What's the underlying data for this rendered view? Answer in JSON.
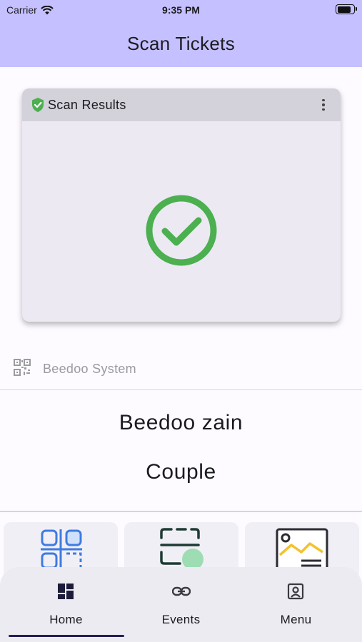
{
  "status_bar": {
    "carrier": "Carrier",
    "time": "9:35 PM",
    "battery_level": 0.9
  },
  "app_bar": {
    "title": "Scan Tickets"
  },
  "scan_result": {
    "title": "Scan Results",
    "status": "success",
    "accent_color": "#4caf50"
  },
  "ticket": {
    "system_label": "Beedoo System",
    "holder_name": "Beedoo zain",
    "ticket_type": "Couple"
  },
  "tiles": [
    {
      "icon": "qr-code-scan-icon"
    },
    {
      "icon": "ticket-scan-icon"
    },
    {
      "icon": "image-gallery-icon"
    }
  ],
  "bottom_nav": {
    "items": [
      {
        "label": "Home",
        "icon": "dashboard-icon",
        "selected": true
      },
      {
        "label": "Events",
        "icon": "link-icon",
        "selected": false
      },
      {
        "label": "Menu",
        "icon": "account-box-icon",
        "selected": false
      }
    ]
  },
  "colors": {
    "app_bar": "#c5c0ff",
    "nav_indicator": "#222058",
    "tile_blue": "#3f7be0",
    "tile_dark": "#1e3b33",
    "tile_yellow": "#f2c230"
  }
}
